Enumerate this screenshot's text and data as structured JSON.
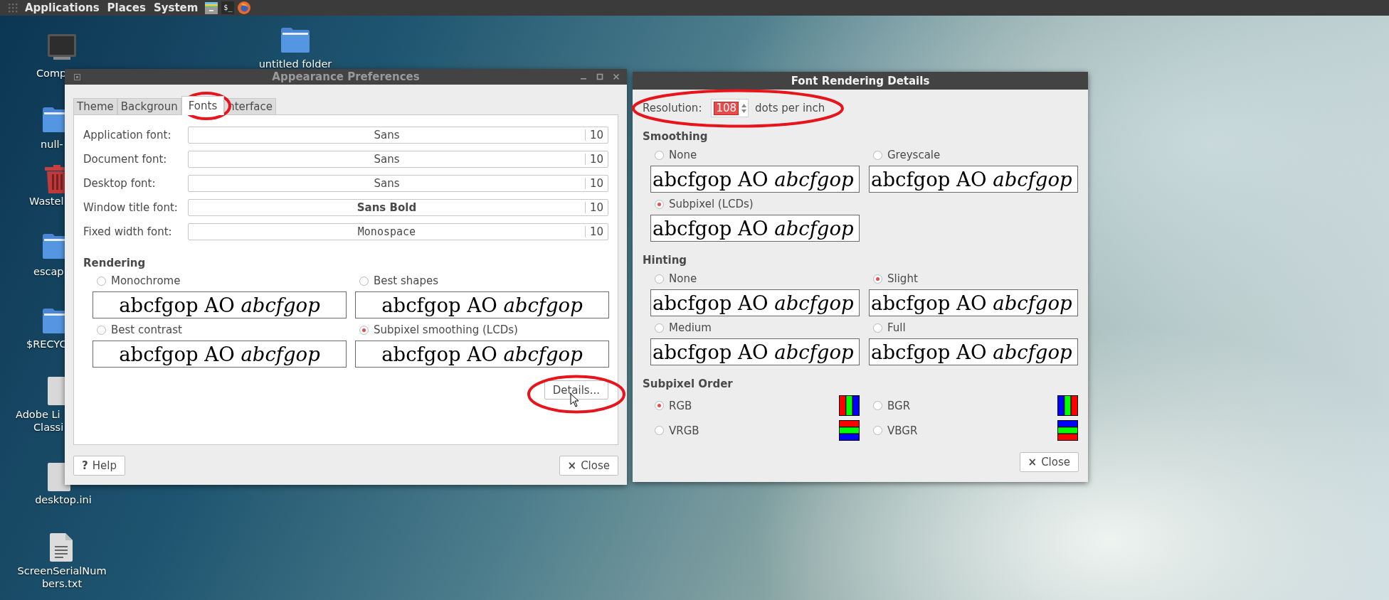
{
  "top_panel": {
    "menus": [
      "Applications",
      "Places",
      "System"
    ],
    "terminal_glyph": "$_"
  },
  "desktop_icons": [
    {
      "kind": "computer",
      "lines": [
        "Comp"
      ]
    },
    {
      "kind": "folder",
      "lines": [
        "untitled folder"
      ]
    },
    {
      "kind": "folder",
      "lines": [
        "null-"
      ]
    },
    {
      "kind": "trash",
      "lines": [
        "Wastel"
      ]
    },
    {
      "kind": "folder",
      "lines": [
        "escap"
      ]
    },
    {
      "kind": "folder",
      "lines": [
        "$RECYC"
      ]
    },
    {
      "kind": "file",
      "lines": [
        "Adobe Li",
        "Classi"
      ]
    },
    {
      "kind": "file",
      "lines": [
        "desktop.ini"
      ]
    },
    {
      "kind": "text",
      "lines": [
        "ScreenSerialNum",
        "bers.txt"
      ]
    }
  ],
  "appearance_window": {
    "title": "Appearance Preferences",
    "tabs": [
      {
        "label": "Theme",
        "selected": false
      },
      {
        "label": "Backgroun",
        "selected": false
      },
      {
        "label": "Fonts",
        "selected": true
      },
      {
        "label": "nterface",
        "selected": false
      }
    ],
    "font_rows": [
      {
        "label": "Application font:",
        "font": "Sans",
        "size": "10",
        "kind": "regular"
      },
      {
        "label": "Document font:",
        "font": "Sans",
        "size": "10",
        "kind": "regular"
      },
      {
        "label": "Desktop font:",
        "font": "Sans",
        "size": "10",
        "kind": "regular"
      },
      {
        "label": "Window title font:",
        "font": "Sans Bold",
        "size": "10",
        "kind": "bold"
      },
      {
        "label": "Fixed width font:",
        "font": "Monospace",
        "size": "10",
        "kind": "mono"
      }
    ],
    "rendering": {
      "heading": "Rendering",
      "options": [
        {
          "label": "Monochrome",
          "selected": false,
          "preview": "abcfgop AO *abcfgop*"
        },
        {
          "label": "Best shapes",
          "selected": false,
          "preview": "abcfgop AO *abcfgop*"
        },
        {
          "label": "Best contrast",
          "selected": false,
          "preview": "abcfgop AO *abcfgop*"
        },
        {
          "label": "Subpixel smoothing (LCDs)",
          "selected": true,
          "preview": "abcfgop AO *abcfgop*"
        }
      ]
    },
    "details_button": "Details...",
    "help_button": {
      "icon": "?",
      "label": "Help"
    },
    "close_button": {
      "icon": "×",
      "label": "Close"
    }
  },
  "details_window": {
    "title": "Font Rendering Details",
    "resolution": {
      "label": "Resolution:",
      "value": "108",
      "unit": "dots per inch"
    },
    "smoothing": {
      "heading": "Smoothing",
      "options": [
        {
          "label": "None",
          "selected": false,
          "preview": "abcfgop AO *abcfgop*"
        },
        {
          "label": "Greyscale",
          "selected": false,
          "preview": "abcfgop AO *abcfgop*"
        },
        {
          "label": "Subpixel (LCDs)",
          "selected": true,
          "preview": "abcfgop AO *abcfgop*"
        }
      ]
    },
    "hinting": {
      "heading": "Hinting",
      "options": [
        {
          "label": "None",
          "selected": false,
          "preview": "abcfgop AO *abcfgop*"
        },
        {
          "label": "Slight",
          "selected": true,
          "preview": "abcfgop AO *abcfgop*"
        },
        {
          "label": "Medium",
          "selected": false,
          "preview": "abcfgop AO *abcfgop*"
        },
        {
          "label": "Full",
          "selected": false,
          "preview": "abcfgop AO *abcfgop*"
        }
      ]
    },
    "subpixel_order": {
      "heading": "Subpixel Order",
      "options": [
        {
          "label": "RGB",
          "selected": true,
          "kind": "rgb"
        },
        {
          "label": "BGR",
          "selected": false,
          "kind": "bgr"
        },
        {
          "label": "VRGB",
          "selected": false,
          "kind": "vrgb"
        },
        {
          "label": "VBGR",
          "selected": false,
          "kind": "vbgr"
        }
      ]
    },
    "close_button": {
      "icon": "×",
      "label": "Close"
    }
  }
}
